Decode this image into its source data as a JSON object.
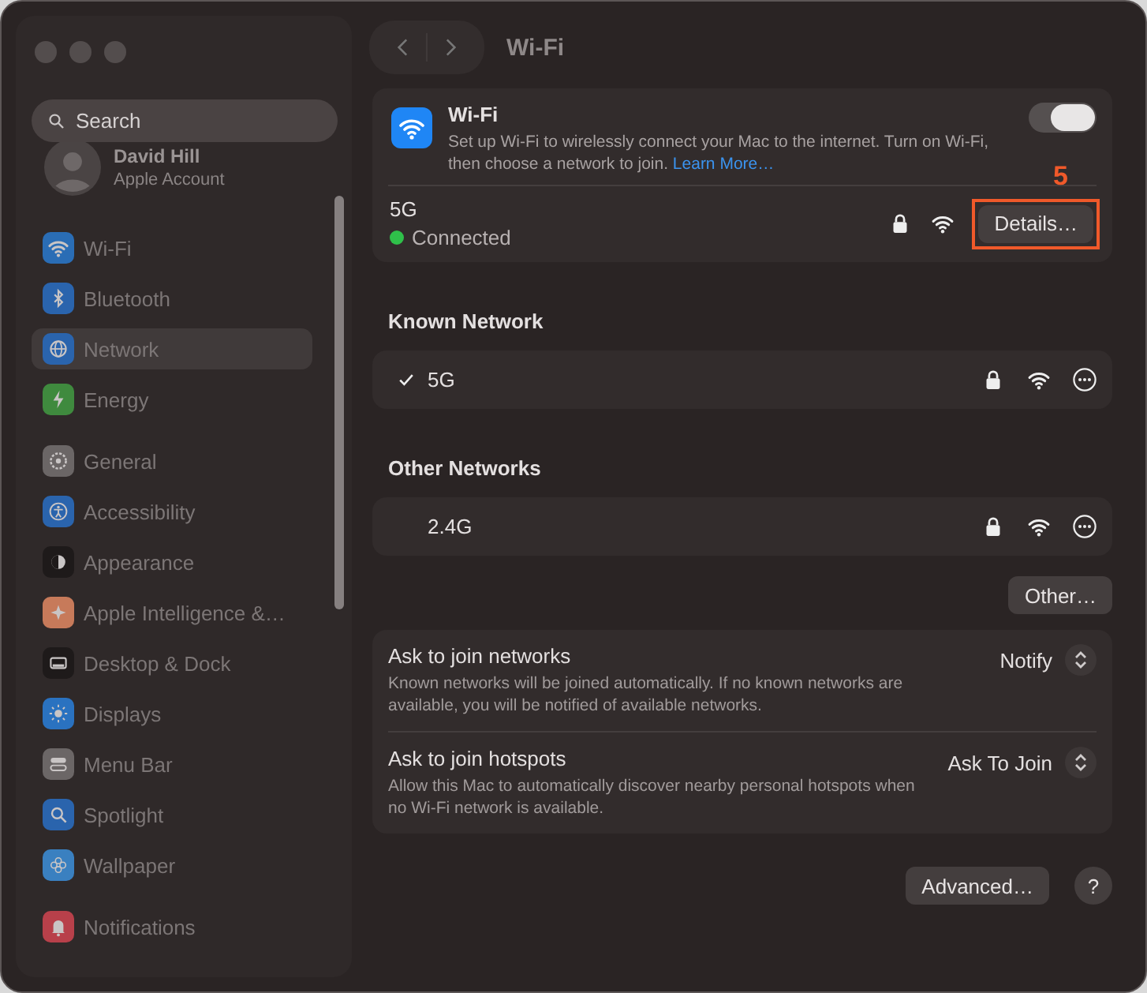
{
  "window": {
    "title": "Wi-Fi"
  },
  "sidebar": {
    "search": {
      "placeholder": "Search"
    },
    "account": {
      "name": "David Hill",
      "subtitle": "Apple Account"
    },
    "groups": [
      [
        {
          "label": "Wi-Fi",
          "kind": "wifi",
          "color": "#2a6db5",
          "selected": false
        },
        {
          "label": "Bluetooth",
          "kind": "bluetooth",
          "color": "#2a64ad",
          "selected": false
        },
        {
          "label": "Network",
          "kind": "globe",
          "color": "#2a64ad",
          "selected": true
        },
        {
          "label": "Energy",
          "kind": "bolt",
          "color": "#3f8a3e",
          "selected": false
        }
      ],
      [
        {
          "label": "General",
          "kind": "gear",
          "color": "#6b6666",
          "selected": false
        },
        {
          "label": "Accessibility",
          "kind": "accessibility",
          "color": "#2a64ad",
          "selected": false
        },
        {
          "label": "Appearance",
          "kind": "appearance",
          "color": "#1e1a1a",
          "selected": false
        },
        {
          "label": "Apple Intelligence &…",
          "kind": "sparkle",
          "color": "#c77a5a",
          "selected": false
        },
        {
          "label": "Desktop & Dock",
          "kind": "dock",
          "color": "#1e1a1a",
          "selected": false
        },
        {
          "label": "Displays",
          "kind": "sun",
          "color": "#2a72c0",
          "selected": false
        },
        {
          "label": "Menu Bar",
          "kind": "menubar",
          "color": "#6b6666",
          "selected": false
        },
        {
          "label": "Spotlight",
          "kind": "search",
          "color": "#2a64ad",
          "selected": false
        },
        {
          "label": "Wallpaper",
          "kind": "flower",
          "color": "#3a80c0",
          "selected": false
        }
      ],
      [
        {
          "label": "Notifications",
          "kind": "bell",
          "color": "#b8404a",
          "selected": false
        }
      ]
    ]
  },
  "wifi": {
    "title": "Wi-Fi",
    "description": "Set up Wi-Fi to wirelessly connect your Mac to the internet. Turn on Wi-Fi, then choose a network to join. ",
    "link": "Learn More…",
    "on": true,
    "current": {
      "name": "5G",
      "status": "Connected",
      "locked": true,
      "button": "Details…",
      "annotation": "5"
    }
  },
  "known": {
    "heading": "Known Network",
    "networks": [
      {
        "name": "5G",
        "checked": true,
        "locked": true
      }
    ]
  },
  "other": {
    "heading": "Other Networks",
    "networks": [
      {
        "name": "2.4G",
        "checked": false,
        "locked": true
      }
    ],
    "button": "Other…"
  },
  "settings": [
    {
      "title": "Ask to join networks",
      "description": "Known networks will be joined automatically. If no known networks are available, you will be notified of available networks.",
      "value": "Notify"
    },
    {
      "title": "Ask to join hotspots",
      "description": "Allow this Mac to automatically discover nearby personal hotspots when no Wi-Fi network is available.",
      "value": "Ask To Join"
    }
  ],
  "footer": {
    "advanced": "Advanced…",
    "help": "?"
  }
}
